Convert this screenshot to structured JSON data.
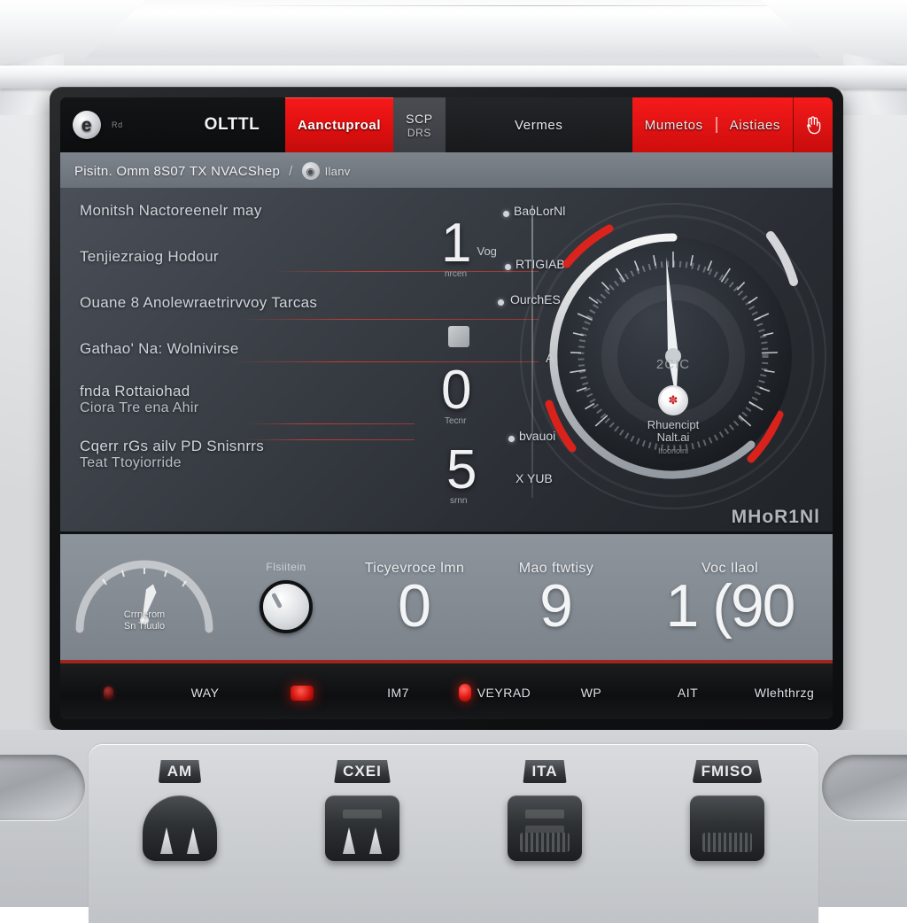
{
  "device": {
    "name": "diagnostic-console",
    "chassis_color": "#d2d4d7",
    "accent_red": "#e51a12",
    "screen_bg": "#2a2e34"
  },
  "navbar": {
    "logo_glyph": "e",
    "logo_sub": "Rd",
    "title": "OLTTL",
    "tabs": [
      {
        "label": "Aanctuproal",
        "style": "red"
      },
      {
        "line1": "SCP",
        "line2": "DRS",
        "style": "grey",
        "icon": "gauge-icon"
      },
      {
        "label": "Vermes",
        "style": "dark"
      }
    ],
    "right_group": {
      "left_label": "Mumetos",
      "right_label": "Aistiaes"
    },
    "right_icon": "hand-icon"
  },
  "breadcrumb": {
    "path": "Pisitn. Omm 8S07 TX NVACShep",
    "separator": "/",
    "chip_icon": "dial-icon",
    "chip_label": "Ilanv"
  },
  "rows": [
    {
      "label": "Monitsh Nactoreenelr may"
    },
    {
      "label": "Tenjiezraiog Hodour"
    },
    {
      "label": "Ouane 8 Anolewraetrirvvoy Tarcas"
    },
    {
      "label": "Gathao' Na: Wolnivirse"
    },
    {
      "label": "fnda Rottaiohad",
      "label2": "Ciora Tre ena Ahir"
    },
    {
      "label": "Cqerr rGs ailv PD Snisnrrs",
      "label2": "Teat Ttoyiorride"
    }
  ],
  "readouts": [
    {
      "value": "1",
      "unit": "Vog",
      "sub": "nrcen"
    },
    {
      "value": "0",
      "unit": "",
      "sub": "Tecnr"
    },
    {
      "value": "5",
      "unit": "",
      "sub": "srnn"
    }
  ],
  "side_labels": [
    "BaoLorNl",
    "RTIGIAB",
    "OurchES",
    "AK",
    "bvauoi",
    "X YUB"
  ],
  "gauge": {
    "watermark": "MHoR1Nl",
    "center_value": "2CIC",
    "badge_glyph": "✽",
    "caption_line1": "Rhuencipt",
    "caption_line2": "Nalt.ai",
    "caption_sub": "Itoorioini",
    "needle_angle_deg": -4,
    "min_angle_deg": -132,
    "max_angle_deg": 132,
    "red_zones": [
      "upper-left",
      "lower-left",
      "lower-right"
    ]
  },
  "metrics": {
    "gauge_caption_line1": "Crrnerom",
    "gauge_caption_line2": "Sn Tluulo",
    "knob_label": "Flsiitein",
    "items": [
      {
        "label": "Ticyevroce lmn",
        "value": "0"
      },
      {
        "label": "Mao ftwtisy",
        "value": "9"
      },
      {
        "label": "Voc Ilaol",
        "value": "1 (90"
      }
    ]
  },
  "indicators": [
    {
      "label": "",
      "led": "dim-small"
    },
    {
      "label": "WAY",
      "led": "none"
    },
    {
      "label": "",
      "led": "battery"
    },
    {
      "label": "IM7",
      "led": "none"
    },
    {
      "label": "VEYRAD",
      "led": "bright"
    },
    {
      "label": "WP",
      "led": "none"
    },
    {
      "label": "AIT",
      "led": "none"
    },
    {
      "label": "Wlehthrzg",
      "led": "none"
    }
  ],
  "deck_buttons": [
    {
      "label": "AM",
      "type": "rocker-round"
    },
    {
      "label": "CXEI",
      "type": "rocker-fins"
    },
    {
      "label": "ITA",
      "type": "rocker-slot"
    },
    {
      "label": "FMISO",
      "type": "rocker-grip"
    }
  ]
}
